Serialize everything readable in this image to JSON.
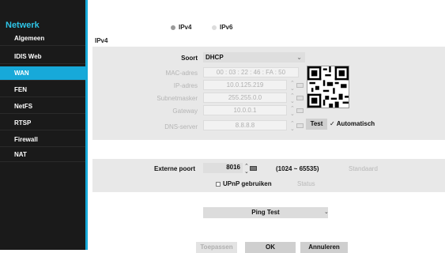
{
  "sidebar": {
    "title": "Netwerk",
    "items": [
      {
        "label": "Algemeen"
      },
      {
        "label": "IDIS Web"
      },
      {
        "label": "WAN"
      },
      {
        "label": "FEN"
      },
      {
        "label": "NetFS"
      },
      {
        "label": "RTSP"
      },
      {
        "label": "Firewall"
      },
      {
        "label": "NAT"
      }
    ],
    "active": "WAN"
  },
  "ip_mode": {
    "ipv4": "IPv4",
    "ipv6": "IPv6",
    "selected": "IPv4"
  },
  "section_label": "IPv4",
  "form": {
    "soort_label": "Soort",
    "soort_value": "DHCP",
    "mac_label": "MAC-adres",
    "mac_value": "00 : 03 : 22 : 46 : FA : 50",
    "ip_label": "IP-adres",
    "ip_value": "10.0.125.219",
    "subnet_label": "Subnetmasker",
    "subnet_value": "255.255.0.0",
    "gateway_label": "Gateway",
    "gateway_value": "10.0.0.1",
    "dns_label": "DNS-server",
    "dns_value": "8.8.8.8",
    "test_label": "Test",
    "auto_label": "Automatisch"
  },
  "port": {
    "label": "Externe poort",
    "value": "8016",
    "range": "(1024 ~ 65535)",
    "standard_label": "Standaard",
    "upnp_label": "UPnP gebruiken",
    "status_label": "Status"
  },
  "ping_test_label": "Ping Test",
  "footer": {
    "apply": "Toepassen",
    "ok": "OK",
    "cancel": "Annuleren"
  }
}
